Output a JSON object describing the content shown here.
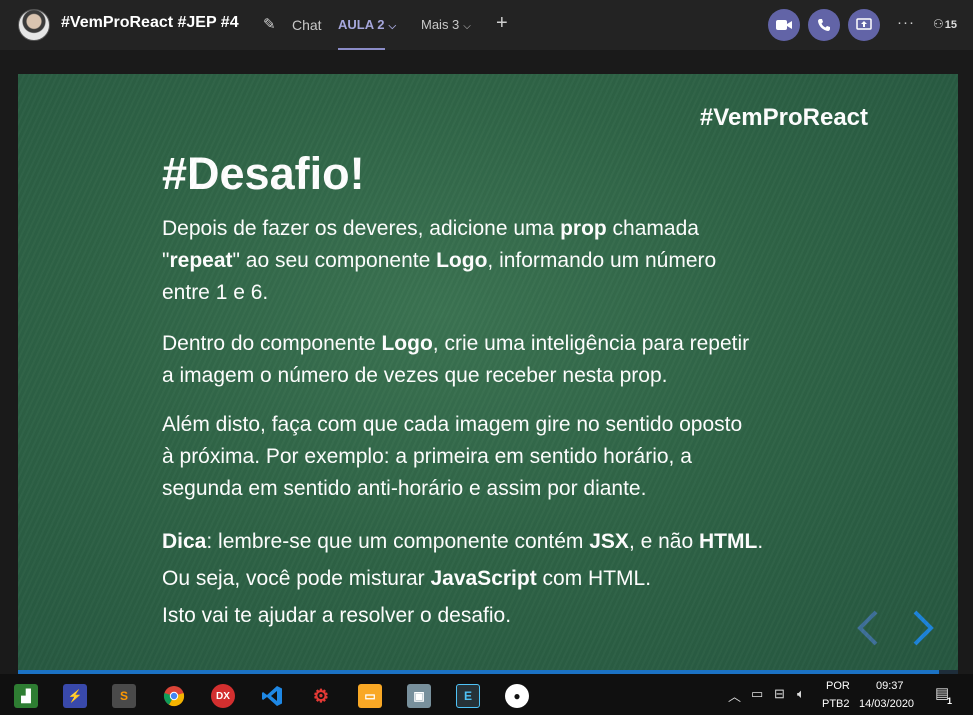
{
  "header": {
    "meeting_title": "#VemProReact #JEP #4",
    "tabs": [
      {
        "label": "Chat"
      },
      {
        "label": "AULA 2"
      },
      {
        "label": "Mais 3"
      }
    ],
    "participants_count": "15",
    "accent_color": "#6264a7"
  },
  "slide": {
    "hashtag": "#VemProReact",
    "title": "#Desafio!",
    "p1": [
      "Depois de fazer os deveres, adicione uma ",
      "prop",
      " chamada",
      "\"",
      "repeat",
      "\" ao seu componente ",
      "Logo",
      ", informando um número",
      "entre 1 e 6."
    ],
    "p2": [
      "Dentro do componente ",
      "Logo",
      ", crie uma inteligência para repetir",
      "a imagem o número de vezes que receber nesta prop."
    ],
    "p3": [
      "Além disto, faça com que cada imagem gire no sentido oposto",
      "à próxima. Por exemplo: a primeira em sentido horário, a",
      "segunda em sentido anti-horário e assim por diante."
    ],
    "p4": [
      "Dica",
      ": lembre-se que um componente contém ",
      "JSX",
      ", e não ",
      "HTML",
      ".",
      "Ou seja, você pode misturar ",
      "JavaScript",
      " com HTML.",
      "Isto vai te ajudar a resolver o desafio."
    ],
    "background_color": "#2f6446",
    "progress_fraction": 0.98
  },
  "taskbar": {
    "apps": [
      "charts-app",
      "power-app",
      "sublime-text",
      "chrome",
      "dx-app",
      "vscode",
      "gears-app",
      "file-explorer",
      "photos-app",
      "terminal-app",
      "github-app"
    ],
    "language_line1": "POR",
    "language_line2": "PTB2",
    "time": "09:37",
    "date": "14/03/2020",
    "notification_count": "1"
  }
}
